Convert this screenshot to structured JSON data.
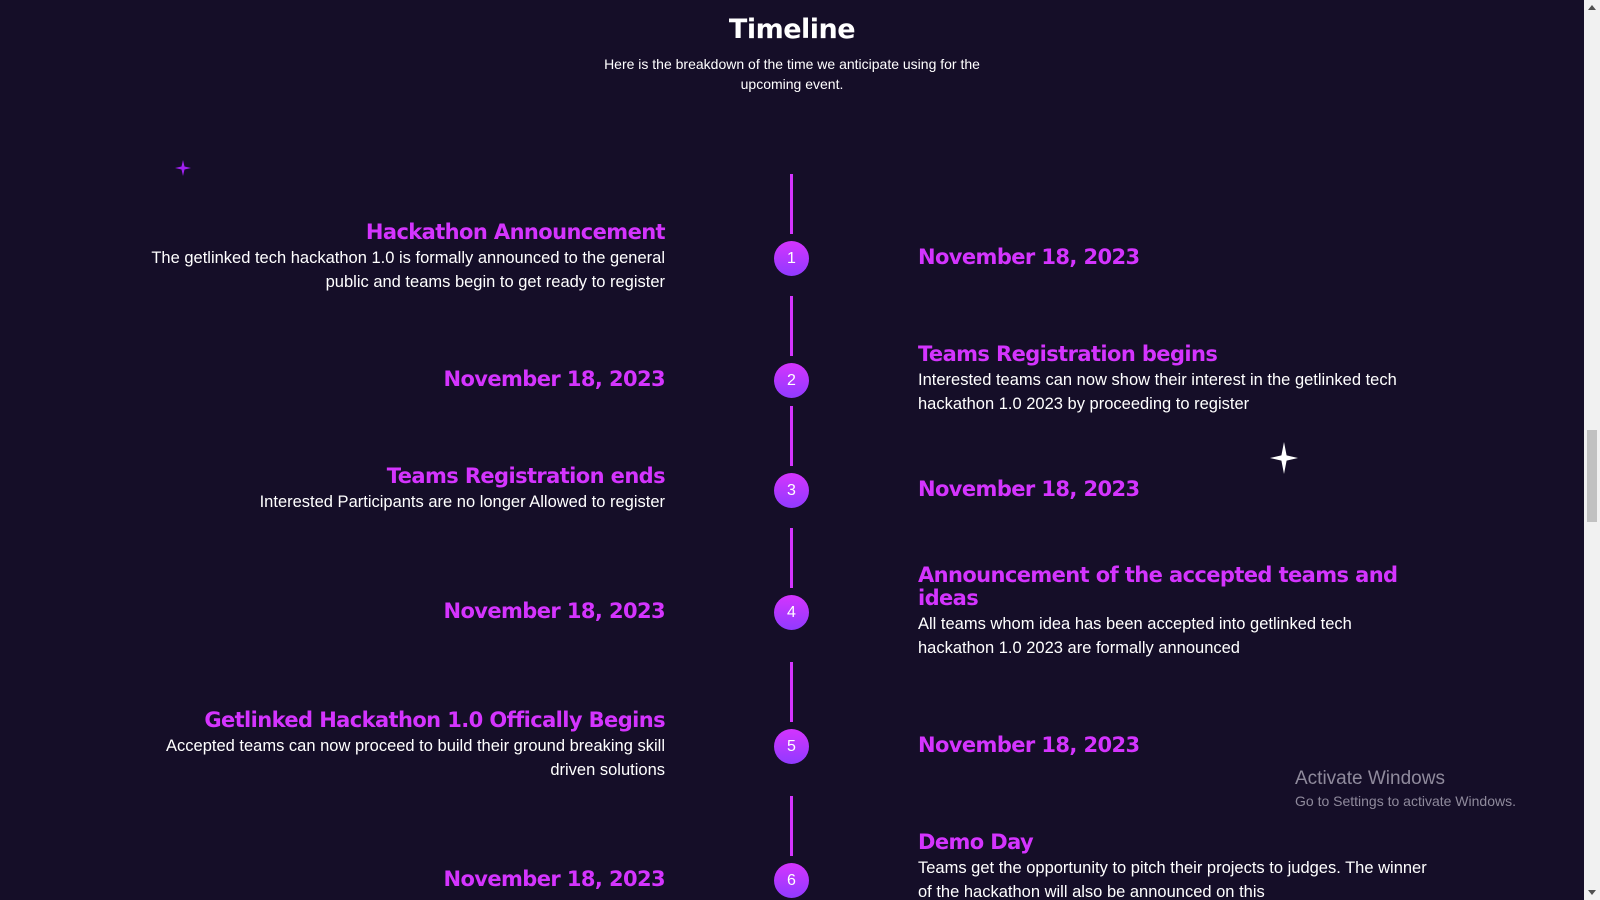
{
  "header": {
    "title": "Timeline",
    "subtitle": "Here is the breakdown of the time we anticipate using for the upcoming event."
  },
  "events": [
    {
      "number": "1",
      "title": "Hackathon Announcement",
      "description": "The getlinked tech hackathon 1.0 is formally announced to the general public and teams begin to get ready to register",
      "date": "November 18, 2023"
    },
    {
      "number": "2",
      "title": "Teams Registration begins",
      "description": "Interested teams can now show their interest in the getlinked tech hackathon 1.0 2023 by proceeding to register",
      "date": "November 18, 2023"
    },
    {
      "number": "3",
      "title": "Teams Registration ends",
      "description": "Interested Participants are no longer Allowed to register",
      "date": "November 18, 2023"
    },
    {
      "number": "4",
      "title": "Announcement of the accepted teams and ideas",
      "description": "All teams whom idea has been accepted into getlinked tech hackathon 1.0 2023 are formally announced",
      "date": "November 18, 2023"
    },
    {
      "number": "5",
      "title": "Getlinked Hackathon 1.0 Offically Begins",
      "description": "Accepted teams can now proceed to build their ground breaking skill driven solutions",
      "date": "November 18, 2023"
    },
    {
      "number": "6",
      "title": "Demo Day",
      "description": "Teams get the opportunity to pitch their projects to judges. The winner of the hackathon will also be announced on this",
      "date": "November 18, 2023"
    }
  ],
  "watermark": {
    "title": "Activate Windows",
    "subtitle": "Go to Settings to activate Windows."
  },
  "colors": {
    "background": "#150e28",
    "accent": "#d434fe",
    "accent_secondary": "#903aff",
    "text": "#ffffff"
  },
  "icons": {
    "decor_star_small": "sparkle-star-icon",
    "decor_star_large": "sparkle-star-icon"
  }
}
